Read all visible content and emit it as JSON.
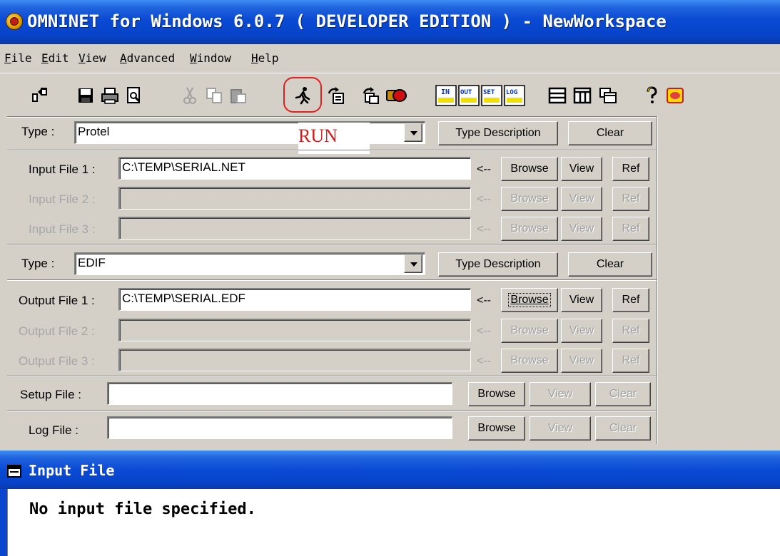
{
  "window": {
    "title": "OMNINET for Windows 6.0.7 ( DEVELOPER EDITION ) - NewWorkspace"
  },
  "menu": {
    "file": {
      "first": "F",
      "rest": "ile"
    },
    "edit": {
      "first": "E",
      "rest": "dit"
    },
    "view": {
      "first": "V",
      "rest": "iew"
    },
    "advanced": {
      "first": "A",
      "rest": "dvanced"
    },
    "window": {
      "first": "W",
      "rest": "indow"
    },
    "help": {
      "first": "H",
      "rest": "elp"
    }
  },
  "toolbar": {
    "icons": [
      "workspace-icon",
      "save-icon",
      "print-icon",
      "print-preview-icon",
      "cut-icon",
      "copy-icon",
      "paste-icon",
      "run-icon",
      "export-icon",
      "copy-window-icon",
      "stop-icon",
      "in-icon",
      "out-icon",
      "set-icon",
      "log-icon",
      "horizontal-split-icon",
      "vertical-split-icon",
      "cascade-icon",
      "help-icon",
      "about-icon"
    ],
    "badges": {
      "in": "IN",
      "out": "OUT",
      "set": "SET",
      "log": "LOG"
    },
    "highlight_color": "#e02020"
  },
  "annotation": {
    "run_label": "RUN"
  },
  "input_section": {
    "type_label": "Type :",
    "type_value": "Protel",
    "type_description_button": "Type Description",
    "clear_button": "Clear",
    "files": [
      {
        "label": "Input File 1 :",
        "value": "C:\\TEMP\\SERIAL.NET",
        "enabled": true
      },
      {
        "label": "Input File 2 :",
        "value": "",
        "enabled": false
      },
      {
        "label": "Input File 3 :",
        "value": "",
        "enabled": false
      }
    ]
  },
  "output_section": {
    "type_label": "Type :",
    "type_value": "EDIF",
    "type_description_button": "Type Description",
    "clear_button": "Clear",
    "files": [
      {
        "label": "Output File 1 :",
        "value": "C:\\TEMP\\SERIAL.EDF",
        "enabled": true
      },
      {
        "label": "Output File 2 :",
        "value": "",
        "enabled": false
      },
      {
        "label": "Output File 3 :",
        "value": "",
        "enabled": false
      }
    ]
  },
  "file_row_buttons": {
    "arrow": "<--",
    "browse": "Browse",
    "view": "View",
    "ref": "Ref"
  },
  "setup_file": {
    "label": "Setup File :",
    "value": "",
    "browse": "Browse",
    "view": "View",
    "clear": "Clear"
  },
  "log_file": {
    "label": "Log File :",
    "value": "",
    "browse": "Browse",
    "view": "View",
    "clear": "Clear"
  },
  "input_file_panel": {
    "title": "Input File",
    "message": "No input file specified."
  }
}
